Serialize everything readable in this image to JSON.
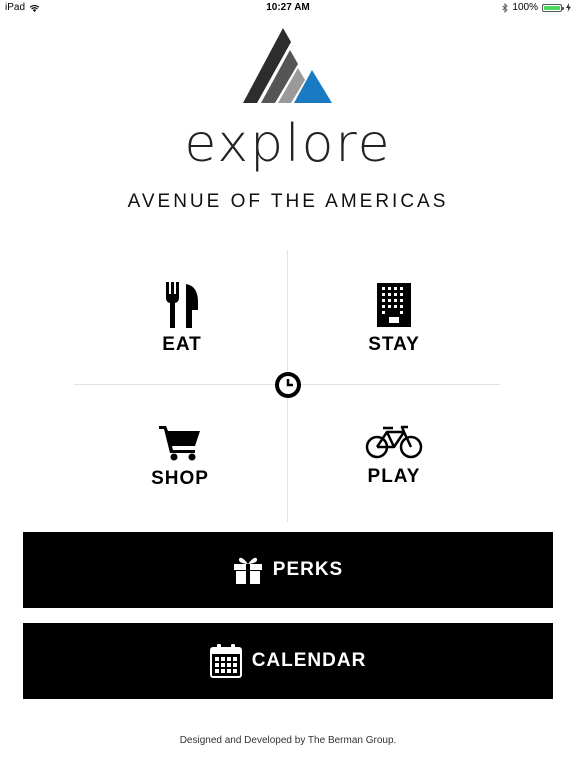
{
  "status_bar": {
    "device": "iPad",
    "time": "10:27 AM",
    "battery": "100%",
    "battery_level": 1.0,
    "wifi_icon": "wifi-icon",
    "bluetooth_icon": "bluetooth-icon",
    "battery_icon": "battery-icon",
    "charging_icon": "charging-bolt-icon"
  },
  "header": {
    "wordmark": "explore",
    "subtitle": "AVENUE OF THE AMERICAS",
    "logo_colors": {
      "dark": "#2d2d2d",
      "gray": "#8c8c8c",
      "blue": "#1a7ac2"
    }
  },
  "categories": [
    {
      "label": "EAT",
      "icon": "fork-knife-icon"
    },
    {
      "label": "STAY",
      "icon": "building-icon"
    },
    {
      "label": "SHOP",
      "icon": "shopping-cart-icon"
    },
    {
      "label": "PLAY",
      "icon": "bicycle-icon"
    }
  ],
  "center_button": {
    "icon": "clock-icon"
  },
  "perks_button": {
    "label": "PERKS",
    "icon": "gift-icon"
  },
  "calendar_button": {
    "label": "CALENDAR",
    "icon": "calendar-icon"
  },
  "footer": {
    "credit": "Designed and Developed by The Berman Group."
  }
}
